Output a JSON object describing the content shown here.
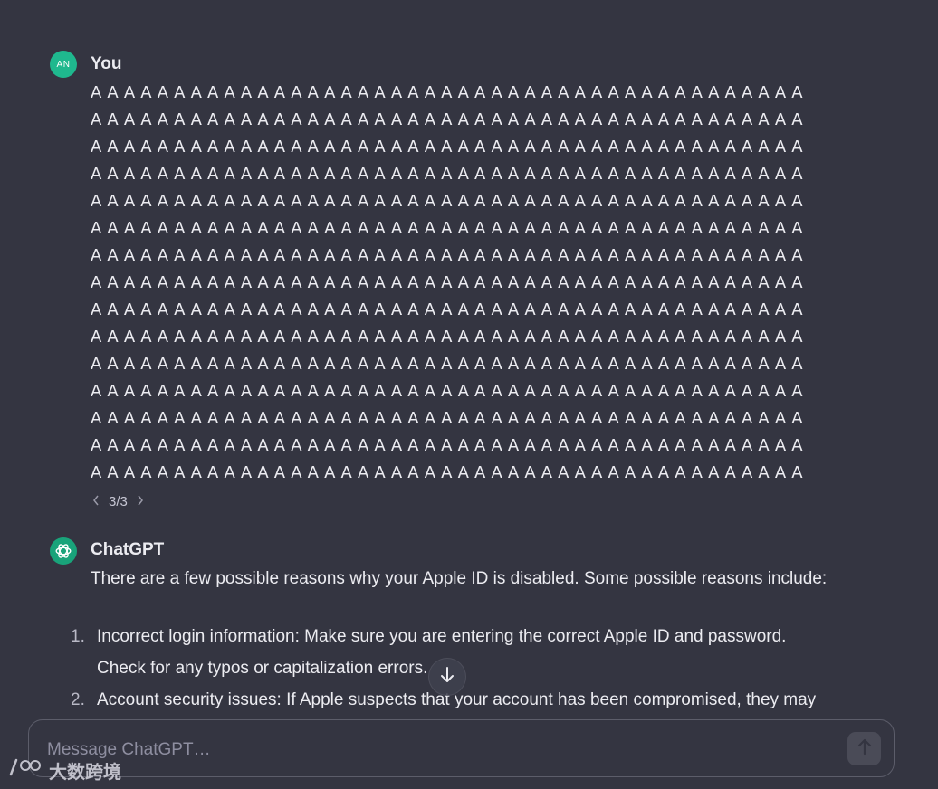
{
  "user_message": {
    "avatar_initials": "AN",
    "author": "You",
    "lines": [
      "AAAAAAAAAAAAAAAAAAAAAAAAAAAAAAAAAAAAAAAAAAA",
      "AAAAAAAAAAAAAAAAAAAAAAAAAAAAAAAAAAAAAAAAAAA",
      "AAAAAAAAAAAAAAAAAAAAAAAAAAAAAAAAAAAAAAAAAAA",
      "AAAAAAAAAAAAAAAAAAAAAAAAAAAAAAAAAAAAAAAAAAA",
      "AAAAAAAAAAAAAAAAAAAAAAAAAAAAAAAAAAAAAAAAAAA",
      "AAAAAAAAAAAAAAAAAAAAAAAAAAAAAAAAAAAAAAAAAAA",
      "AAAAAAAAAAAAAAAAAAAAAAAAAAAAAAAAAAAAAAAAAAA",
      "AAAAAAAAAAAAAAAAAAAAAAAAAAAAAAAAAAAAAAAAAAA",
      "AAAAAAAAAAAAAAAAAAAAAAAAAAAAAAAAAAAAAAAAAAA",
      "AAAAAAAAAAAAAAAAAAAAAAAAAAAAAAAAAAAAAAAAAAA",
      "AAAAAAAAAAAAAAAAAAAAAAAAAAAAAAAAAAAAAAAAAAA",
      "AAAAAAAAAAAAAAAAAAAAAAAAAAAAAAAAAAAAAAAAAAA",
      "AAAAAAAAAAAAAAAAAAAAAAAAAAAAAAAAAAAAAAAAAAA",
      "AAAAAAAAAAAAAAAAAAAAAAAAAAAAAAAAAAAAAAAAAAA",
      "AAAAAAAAAAAAAAAAAAAAAAAAAAAAAAAAAAAAAAAAAAA"
    ],
    "pager": {
      "current": "3",
      "separator": "/",
      "total": "3",
      "prev_icon": "chevron-left-icon",
      "next_icon": "chevron-right-icon"
    }
  },
  "assistant_message": {
    "avatar_icon": "openai-logo-icon",
    "author": "ChatGPT",
    "intro": "There are a few possible reasons why your Apple ID is disabled. Some possible reasons include:",
    "items": [
      {
        "number": "1.",
        "line1": "Incorrect login information: Make sure you are entering the correct Apple ID and password.",
        "line2": "Check for any typos or capitalization errors."
      },
      {
        "number": "2.",
        "line1": "Account security issues: If Apple suspects that your account has been compromised, they may",
        "line2": ""
      }
    ]
  },
  "scroll_button": {
    "icon": "arrow-down-icon"
  },
  "composer": {
    "placeholder": "Message ChatGPT…",
    "send_icon": "arrow-up-icon"
  },
  "watermark": {
    "text": "大数跨境",
    "icon": "watermark-logo-icon"
  },
  "colors": {
    "background": "#343541",
    "user_avatar": "#1fb88e",
    "bot_avatar": "#19a37a",
    "text": "#ececf1",
    "muted": "#8e8ea0"
  }
}
